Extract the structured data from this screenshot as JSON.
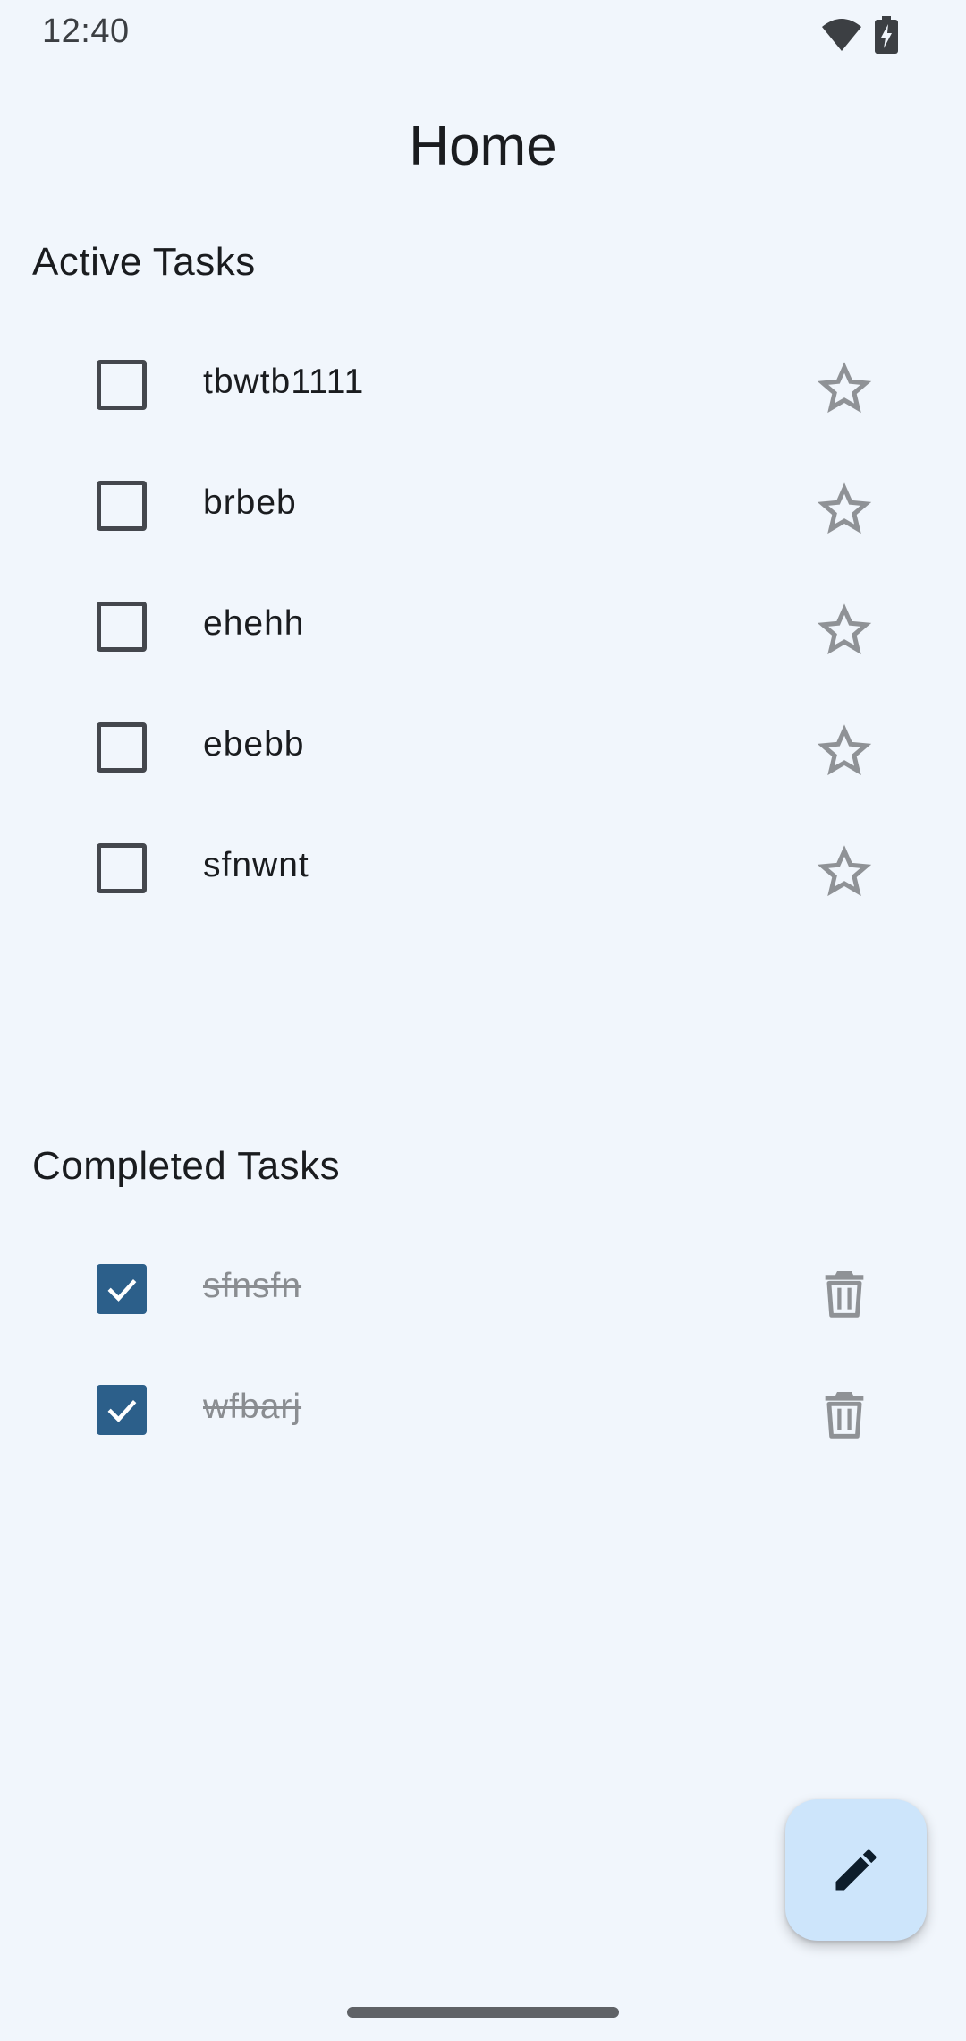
{
  "status_bar": {
    "time": "12:40",
    "icons": [
      "wifi-icon",
      "battery-charging-icon"
    ]
  },
  "header": {
    "title": "Home"
  },
  "active_section": {
    "title": "Active Tasks",
    "tasks": [
      {
        "label": "tbwtb1111",
        "checked": false,
        "icon": "star-outline-icon"
      },
      {
        "label": "brbeb",
        "checked": false,
        "icon": "star-outline-icon"
      },
      {
        "label": "ehehh",
        "checked": false,
        "icon": "star-outline-icon"
      },
      {
        "label": "ebebb",
        "checked": false,
        "icon": "star-outline-icon"
      },
      {
        "label": "sfnwnt",
        "checked": false,
        "icon": "star-outline-icon"
      }
    ]
  },
  "completed_section": {
    "title": "Completed Tasks",
    "tasks": [
      {
        "label": "sfnsfn",
        "checked": true,
        "icon": "trash-icon"
      },
      {
        "label": "wfbarj",
        "checked": true,
        "icon": "trash-icon"
      }
    ]
  },
  "fab": {
    "icon": "edit-pencil-icon"
  },
  "colors": {
    "background": "#f1f6fc",
    "checkbox_checked": "#2c5f8a",
    "fab_background": "#cde5fb",
    "muted_icon": "#8f9296"
  }
}
